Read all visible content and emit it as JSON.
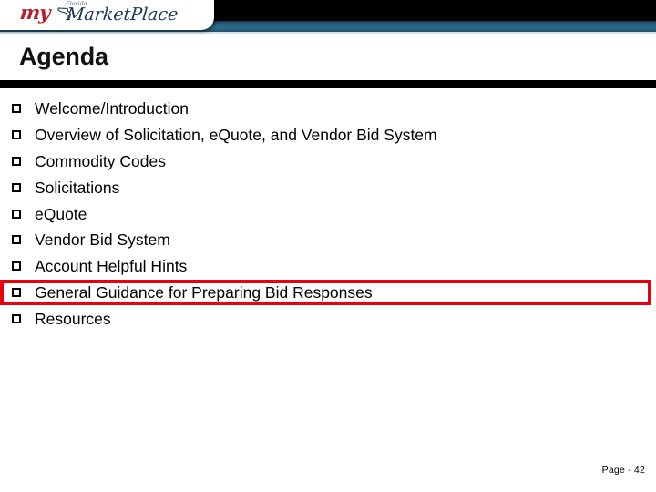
{
  "header": {
    "logo": {
      "name": "myfloridamarketplace-logo",
      "my_text": "my",
      "florida_text": "Florida",
      "marketplace_text": "MarketPlace",
      "my_color": "#b4202a",
      "marketplace_color": "#1d3a56",
      "band_black": "#000000",
      "band_blue": "#2a6183"
    }
  },
  "slide": {
    "title": "Agenda",
    "rule_color": "#000000",
    "highlight_color": "#e8000d",
    "bullet_icon": "hollow-square-bullet-icon",
    "items": [
      {
        "label": "Welcome/Introduction",
        "highlighted": false
      },
      {
        "label": "Overview of Solicitation, eQuote, and Vendor Bid System",
        "highlighted": false
      },
      {
        "label": "Commodity Codes",
        "highlighted": false
      },
      {
        "label": "Solicitations",
        "highlighted": false
      },
      {
        "label": "eQuote",
        "highlighted": false
      },
      {
        "label": "Vendor Bid System",
        "highlighted": false
      },
      {
        "label": "Account Helpful Hints",
        "highlighted": false
      },
      {
        "label": "General Guidance for Preparing Bid Responses",
        "highlighted": true
      },
      {
        "label": "Resources",
        "highlighted": false
      }
    ]
  },
  "footer": {
    "page_label": "Page - 42"
  }
}
